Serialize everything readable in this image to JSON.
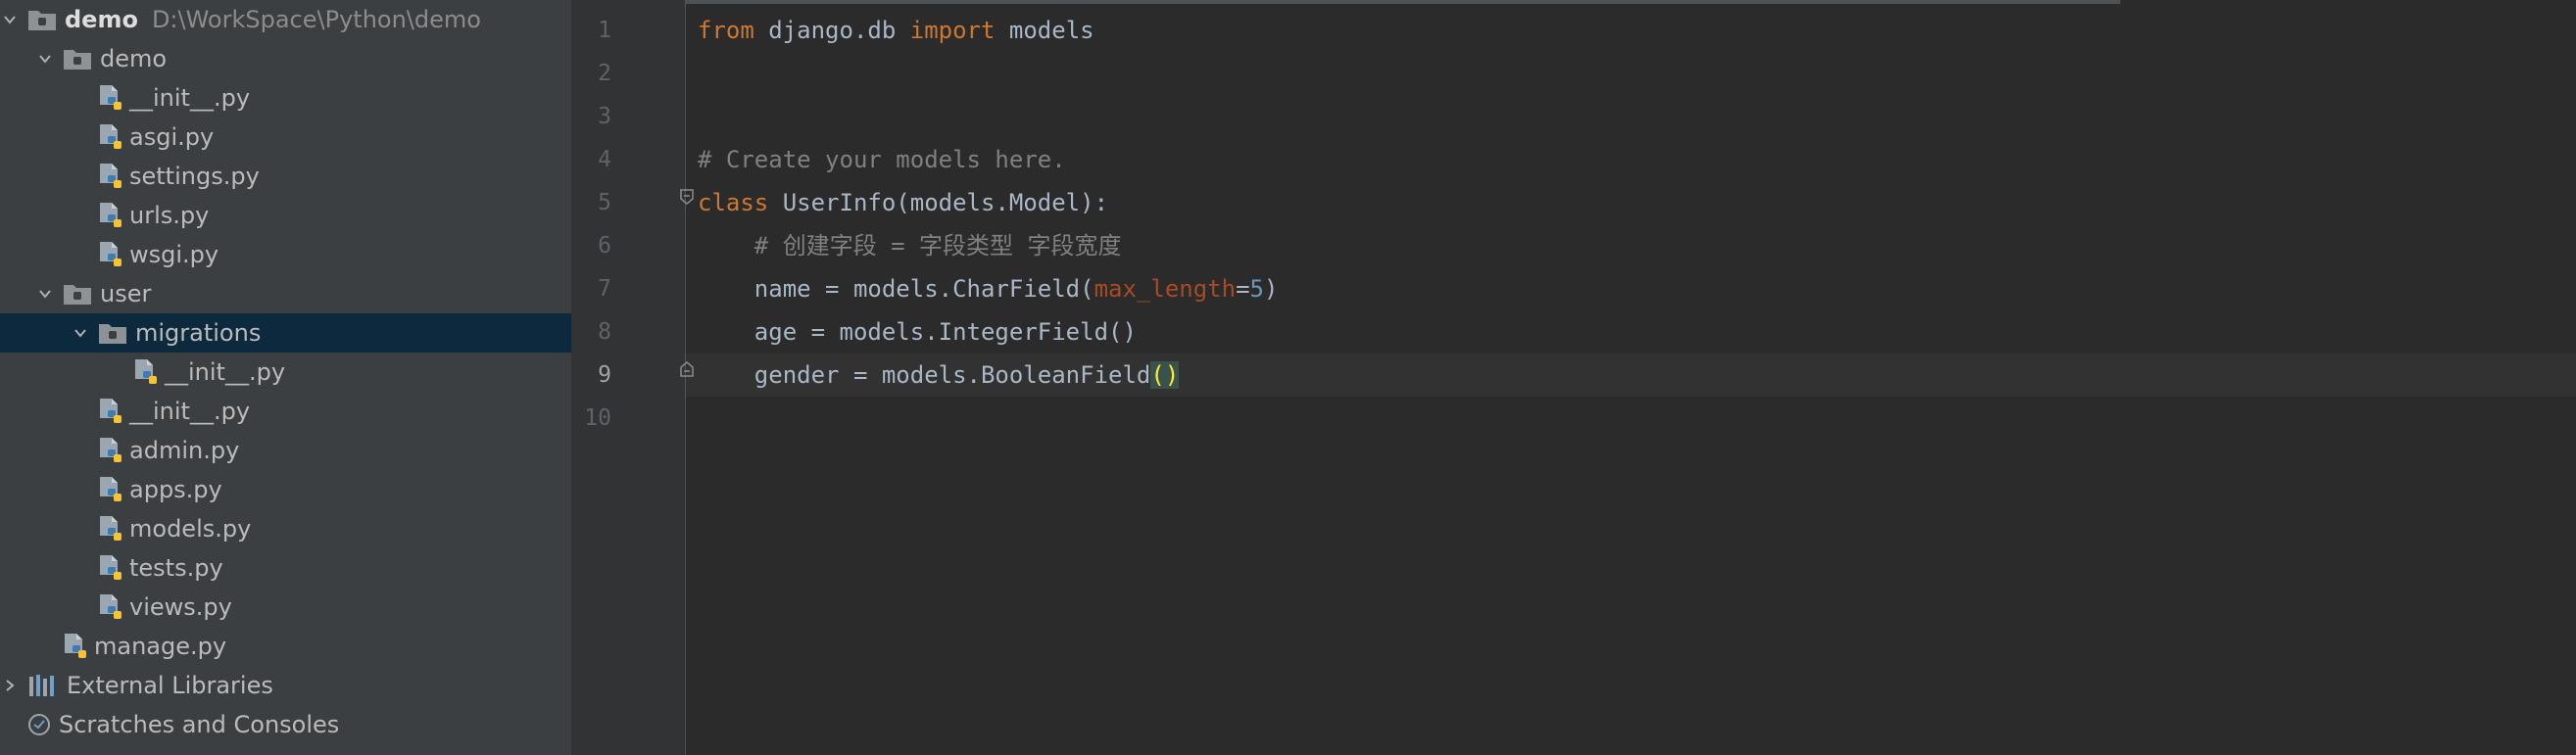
{
  "project_tree": {
    "root": {
      "name": "demo",
      "path": "D:\\WorkSpace\\Python\\demo"
    },
    "items": [
      {
        "label": "demo",
        "type": "folder",
        "level": 1,
        "expanded": true
      },
      {
        "label": "__init__.py",
        "type": "py",
        "level": 2
      },
      {
        "label": "asgi.py",
        "type": "py",
        "level": 2
      },
      {
        "label": "settings.py",
        "type": "py",
        "level": 2
      },
      {
        "label": "urls.py",
        "type": "py",
        "level": 2
      },
      {
        "label": "wsgi.py",
        "type": "py",
        "level": 2
      },
      {
        "label": "user",
        "type": "folder",
        "level": 1,
        "expanded": true
      },
      {
        "label": "migrations",
        "type": "folder",
        "level": 2,
        "expanded": true,
        "selected": true
      },
      {
        "label": "__init__.py",
        "type": "py",
        "level": 3
      },
      {
        "label": "__init__.py",
        "type": "py",
        "level": 2
      },
      {
        "label": "admin.py",
        "type": "py",
        "level": 2
      },
      {
        "label": "apps.py",
        "type": "py",
        "level": 2
      },
      {
        "label": "models.py",
        "type": "py",
        "level": 2
      },
      {
        "label": "tests.py",
        "type": "py",
        "level": 2
      },
      {
        "label": "views.py",
        "type": "py",
        "level": 2
      },
      {
        "label": "manage.py",
        "type": "py",
        "level": 1
      }
    ],
    "external_libraries": "External Libraries",
    "scratches": "Scratches and Consoles"
  },
  "editor": {
    "current_line": 9,
    "line_numbers": [
      "1",
      "2",
      "3",
      "4",
      "5",
      "6",
      "7",
      "8",
      "9",
      "10"
    ],
    "lines": {
      "l1": {
        "kw1": "from",
        "t1": " django.db ",
        "kw2": "import",
        "t2": " models"
      },
      "l4": {
        "comment": "# Create your models here."
      },
      "l5": {
        "kw": "class",
        "t1": " UserInfo(models.Model):"
      },
      "l6": {
        "comment": "    # 创建字段 = 字段类型 字段宽度"
      },
      "l7": {
        "t1": "    name = models.CharField(",
        "param": "max_length",
        "eq": "=",
        "num": "5",
        "t2": ")"
      },
      "l8": {
        "t1": "    age = models.IntegerField()"
      },
      "l9": {
        "t1": "    gender = models.BooleanField",
        "paren": "()"
      }
    }
  },
  "colors": {
    "sidebar_bg": "#3c3f41",
    "editor_bg": "#2b2b2b",
    "keyword": "#cc7832",
    "comment": "#808080",
    "parameter": "#aa4926",
    "number": "#6897bb",
    "selection": "#0d293e"
  }
}
